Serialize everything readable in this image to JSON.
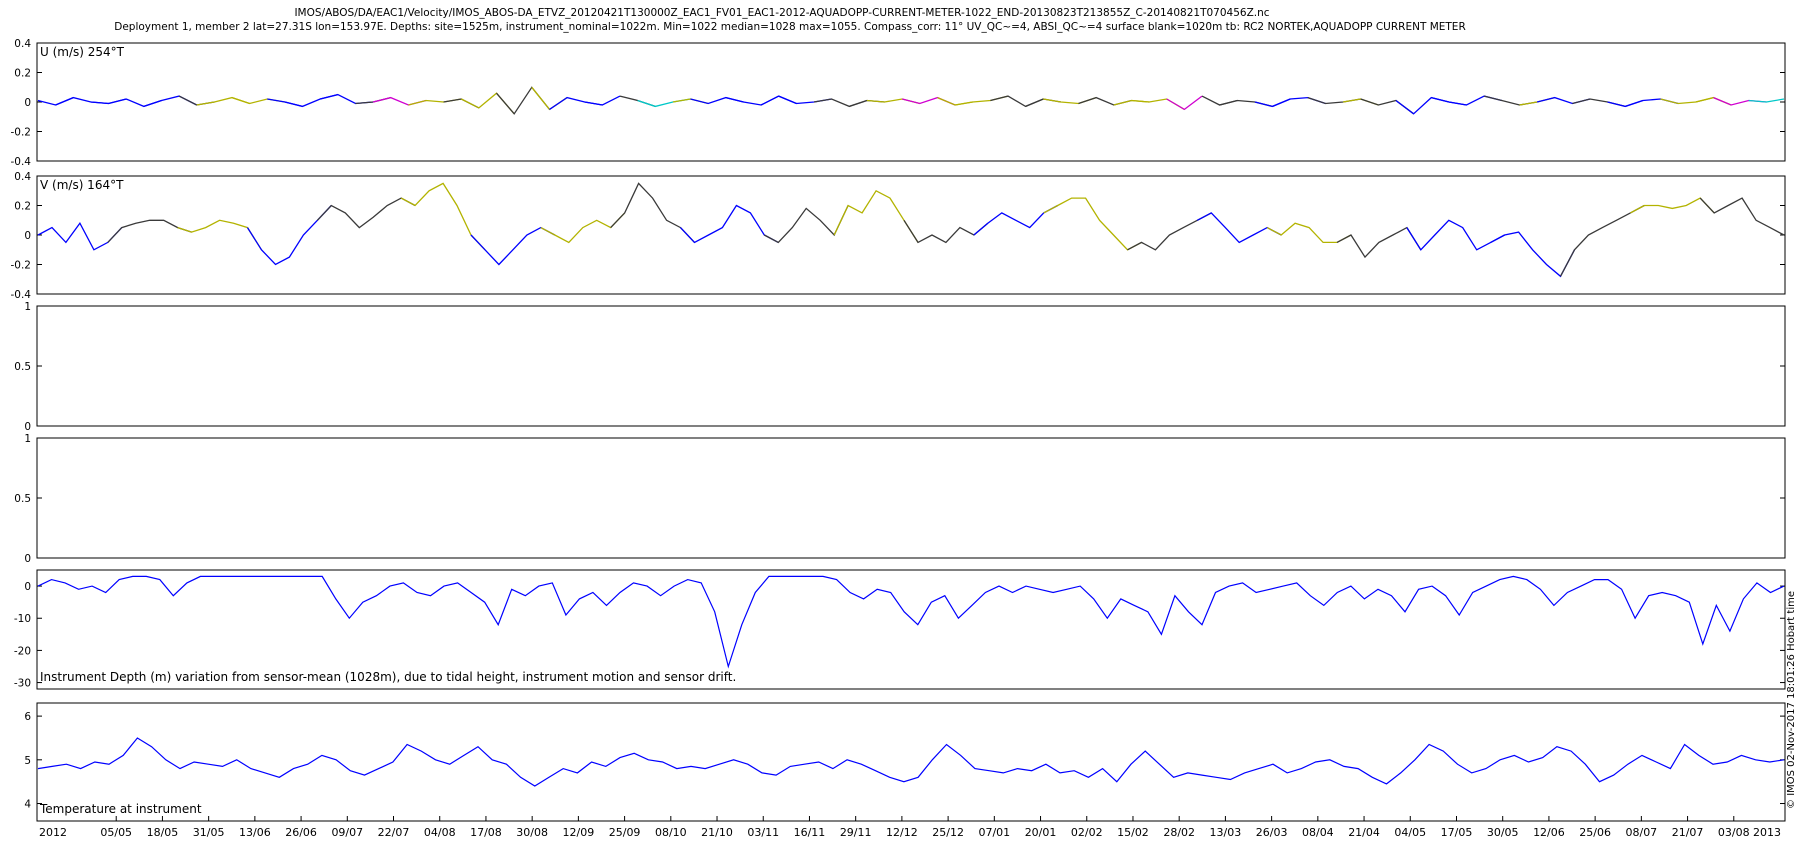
{
  "figure": {
    "title": "IMOS/ABOS/DA/EAC1/Velocity/IMOS_ABOS-DA_ETVZ_20120421T130000Z_EAC1_FV01_EAC1-2012-AQUADOPP-CURRENT-METER-1022_END-20130823T213855Z_C-20140821T070456Z.nc",
    "subtitle": "Deployment 1, member 2 lat=27.31S lon=153.97E. Depths: site=1525m, instrument_nominal=1022m. Min=1022 median=1028 max=1055. Compass_corr: 11° UV_QC~=4, ABSI_QC~=4 surface blank=1020m tb: RC2 NORTEK,AQUADOPP CURRENT METER",
    "side_note": "© IMOS 02-Nov-2017 18:01:26 Hobart time"
  },
  "chart_data": [
    {
      "type": "line",
      "label": "U (m/s) 254°T",
      "ylim": [
        -0.4,
        0.4
      ],
      "yticks": [
        "0.4",
        "0.2",
        "0",
        "-0.2",
        "-0.4"
      ],
      "ytick_values": [
        0.4,
        0.2,
        0,
        -0.2,
        -0.4
      ],
      "grid": false,
      "qc_colors": [
        "#0000ff",
        "#3a3a3a",
        "#b3b300",
        "#d000d0",
        "#00c8c8"
      ],
      "qc_segments": [
        "#0000ff",
        "#0000ff",
        "#0000ff",
        "#0000ff",
        "#0000ff",
        "#3a3a3a",
        "#b3b300",
        "#b3b300",
        "#0000ff",
        "#0000ff",
        "#0000ff",
        "#3a3a3a",
        "#d000d0",
        "#b3b300",
        "#3a3a3a",
        "#b3b300",
        "#3a3a3a",
        "#b3b300",
        "#0000ff",
        "#0000ff",
        "#3a3a3a",
        "#00c8c8",
        "#b3b300",
        "#0000ff",
        "#0000ff",
        "#0000ff",
        "#0000ff",
        "#3a3a3a",
        "#3a3a3a",
        "#b3b300",
        "#d000d0",
        "#b3b300",
        "#b3b300",
        "#3a3a3a",
        "#3a3a3a",
        "#b3b300",
        "#3a3a3a",
        "#b3b300",
        "#b3b300",
        "#d000d0",
        "#3a3a3a",
        "#3a3a3a",
        "#0000ff",
        "#0000ff",
        "#3a3a3a",
        "#b3b300",
        "#3a3a3a",
        "#0000ff",
        "#0000ff",
        "#0000ff",
        "#3a3a3a",
        "#b3b300",
        "#0000ff",
        "#3a3a3a",
        "#0000ff",
        "#0000ff",
        "#b3b300",
        "#b3b300",
        "#d000d0",
        "#00c8c8"
      ],
      "values": [
        0.01,
        -0.02,
        0.03,
        0.0,
        -0.01,
        0.02,
        -0.03,
        0.01,
        0.04,
        -0.02,
        0.0,
        0.03,
        -0.01,
        0.02,
        0.0,
        -0.03,
        0.02,
        0.05,
        -0.01,
        0.0,
        0.03,
        -0.02,
        0.01,
        0.0,
        0.02,
        -0.04,
        0.06,
        -0.08,
        0.1,
        -0.05,
        0.03,
        0.0,
        -0.02,
        0.04,
        0.01,
        -0.03,
        0.0,
        0.02,
        -0.01,
        0.03,
        0.0,
        -0.02,
        0.04,
        -0.01,
        0.0,
        0.02,
        -0.03,
        0.01,
        0.0,
        0.02,
        -0.01,
        0.03,
        -0.02,
        0.0,
        0.01,
        0.04,
        -0.03,
        0.02,
        0.0,
        -0.01,
        0.03,
        -0.02,
        0.01,
        0.0,
        0.02,
        -0.05,
        0.04,
        -0.02,
        0.01,
        0.0,
        -0.03,
        0.02,
        0.03,
        -0.01,
        0.0,
        0.02,
        -0.02,
        0.01,
        -0.08,
        0.03,
        0.0,
        -0.02,
        0.04,
        0.01,
        -0.02,
        0.0,
        0.03,
        -0.01,
        0.02,
        0.0,
        -0.03,
        0.01,
        0.02,
        -0.01,
        0.0,
        0.03,
        -0.02,
        0.01,
        0.0,
        0.02
      ]
    },
    {
      "type": "line",
      "label": "V (m/s) 164°T",
      "ylim": [
        -0.4,
        0.4
      ],
      "yticks": [
        "0.4",
        "0.2",
        "0",
        "-0.2",
        "-0.4"
      ],
      "ytick_values": [
        0.4,
        0.2,
        0,
        -0.2,
        -0.4
      ],
      "grid": false,
      "values": [
        0.0,
        0.05,
        -0.05,
        0.08,
        -0.1,
        -0.05,
        0.05,
        0.08,
        0.1,
        0.1,
        0.05,
        0.02,
        0.05,
        0.1,
        0.08,
        0.05,
        -0.1,
        -0.2,
        -0.15,
        0.0,
        0.1,
        0.2,
        0.15,
        0.05,
        0.12,
        0.2,
        0.25,
        0.2,
        0.3,
        0.35,
        0.2,
        0.0,
        -0.1,
        -0.2,
        -0.1,
        0.0,
        0.05,
        0.0,
        -0.05,
        0.05,
        0.1,
        0.05,
        0.15,
        0.35,
        0.25,
        0.1,
        0.05,
        -0.05,
        0.0,
        0.05,
        0.2,
        0.15,
        0.0,
        -0.05,
        0.05,
        0.18,
        0.1,
        0.0,
        0.2,
        0.15,
        0.3,
        0.25,
        0.1,
        -0.05,
        0.0,
        -0.05,
        0.05,
        0.0,
        0.08,
        0.15,
        0.1,
        0.05,
        0.15,
        0.2,
        0.25,
        0.25,
        0.1,
        0.0,
        -0.1,
        -0.05,
        -0.1,
        0.0,
        0.05,
        0.1,
        0.15,
        0.05,
        -0.05,
        0.0,
        0.05,
        0.0,
        0.08,
        0.05,
        -0.05,
        -0.05,
        0.0,
        -0.15,
        -0.05,
        0.0,
        0.05,
        -0.1,
        0.0,
        0.1,
        0.05,
        -0.1,
        -0.05,
        0.0,
        0.02,
        -0.1,
        -0.2,
        -0.28,
        -0.1,
        0.0,
        0.05,
        0.1,
        0.15,
        0.2,
        0.2,
        0.18,
        0.2,
        0.25,
        0.15,
        0.2,
        0.25,
        0.1,
        0.05,
        0.0
      ]
    },
    {
      "type": "line",
      "label": "",
      "ylim": [
        0,
        1
      ],
      "yticks": [
        "1",
        "0.5",
        "0"
      ],
      "ytick_values": [
        1,
        0.5,
        0
      ],
      "grid": false,
      "values": []
    },
    {
      "type": "line",
      "label": "",
      "ylim": [
        0,
        1
      ],
      "yticks": [
        "1",
        "0.5",
        "0"
      ],
      "ytick_values": [
        1,
        0.5,
        0
      ],
      "grid": false,
      "values": []
    },
    {
      "type": "line",
      "label": "Instrument Depth (m) variation from sensor-mean (1028m), due to tidal height, instrument motion and sensor drift.",
      "ylim": [
        -32,
        5
      ],
      "yticks": [
        "0",
        "-10",
        "-20",
        "-30"
      ],
      "ytick_values": [
        0,
        -10,
        -20,
        -30
      ],
      "grid": false,
      "values": [
        0,
        2,
        1,
        -1,
        0,
        -2,
        2,
        3,
        3,
        2,
        -3,
        1,
        3,
        3,
        3,
        3,
        3,
        3,
        3,
        3,
        3,
        3,
        -4,
        -10,
        -5,
        -3,
        0,
        1,
        -2,
        -3,
        0,
        1,
        -2,
        -5,
        -12,
        -1,
        -3,
        0,
        1,
        -9,
        -4,
        -2,
        -6,
        -2,
        1,
        0,
        -3,
        0,
        2,
        1,
        -8,
        -25,
        -12,
        -2,
        3,
        3,
        3,
        3,
        3,
        2,
        -2,
        -4,
        -1,
        -2,
        -8,
        -12,
        -5,
        -3,
        -10,
        -6,
        -2,
        0,
        -2,
        0,
        -1,
        -2,
        -1,
        0,
        -4,
        -10,
        -4,
        -6,
        -8,
        -15,
        -3,
        -8,
        -12,
        -2,
        0,
        1,
        -2,
        -1,
        0,
        1,
        -3,
        -6,
        -2,
        0,
        -4,
        -1,
        -3,
        -8,
        -1,
        0,
        -3,
        -9,
        -2,
        0,
        2,
        3,
        2,
        -1,
        -6,
        -2,
        0,
        2,
        2,
        -1,
        -10,
        -3,
        -2,
        -3,
        -5,
        -18,
        -6,
        -14,
        -4,
        1,
        -2,
        0
      ]
    },
    {
      "type": "line",
      "label": "Temperature at instrument",
      "ylim": [
        3.6,
        6.3
      ],
      "yticks": [
        "6",
        "5",
        "4"
      ],
      "ytick_values": [
        6,
        5,
        4
      ],
      "grid": false,
      "values": [
        4.8,
        4.85,
        4.9,
        4.8,
        4.95,
        4.9,
        5.1,
        5.5,
        5.3,
        5.0,
        4.8,
        4.95,
        4.9,
        4.85,
        5.0,
        4.8,
        4.7,
        4.6,
        4.8,
        4.9,
        5.1,
        5.0,
        4.75,
        4.65,
        4.8,
        4.95,
        5.35,
        5.2,
        5.0,
        4.9,
        5.1,
        5.3,
        5.0,
        4.9,
        4.6,
        4.4,
        4.6,
        4.8,
        4.7,
        4.95,
        4.85,
        5.05,
        5.15,
        5.0,
        4.95,
        4.8,
        4.85,
        4.8,
        4.9,
        5.0,
        4.9,
        4.7,
        4.65,
        4.85,
        4.9,
        4.95,
        4.8,
        5.0,
        4.9,
        4.75,
        4.6,
        4.5,
        4.6,
        5.0,
        5.35,
        5.1,
        4.8,
        4.75,
        4.7,
        4.8,
        4.75,
        4.9,
        4.7,
        4.75,
        4.6,
        4.8,
        4.5,
        4.9,
        5.2,
        4.9,
        4.6,
        4.7,
        4.65,
        4.6,
        4.55,
        4.7,
        4.8,
        4.9,
        4.7,
        4.8,
        4.95,
        5.0,
        4.85,
        4.8,
        4.6,
        4.45,
        4.7,
        5.0,
        5.35,
        5.2,
        4.9,
        4.7,
        4.8,
        5.0,
        5.1,
        4.95,
        5.05,
        5.3,
        5.2,
        4.9,
        4.5,
        4.65,
        4.9,
        5.1,
        4.95,
        4.8,
        5.35,
        5.1,
        4.9,
        4.95,
        5.1,
        5.0,
        4.95,
        5.0
      ]
    }
  ],
  "x_axis": {
    "tick_labels": [
      "2012",
      "05/05",
      "18/05",
      "31/05",
      "13/06",
      "26/06",
      "09/07",
      "22/07",
      "04/08",
      "17/08",
      "30/08",
      "12/09",
      "25/09",
      "08/10",
      "21/10",
      "03/11",
      "16/11",
      "29/11",
      "12/12",
      "25/12",
      "07/01",
      "20/01",
      "02/02",
      "15/02",
      "28/02",
      "13/03",
      "26/03",
      "08/04",
      "21/04",
      "04/05",
      "17/05",
      "30/05",
      "12/06",
      "25/06",
      "08/07",
      "21/07",
      "03/08",
      "2013"
    ]
  }
}
